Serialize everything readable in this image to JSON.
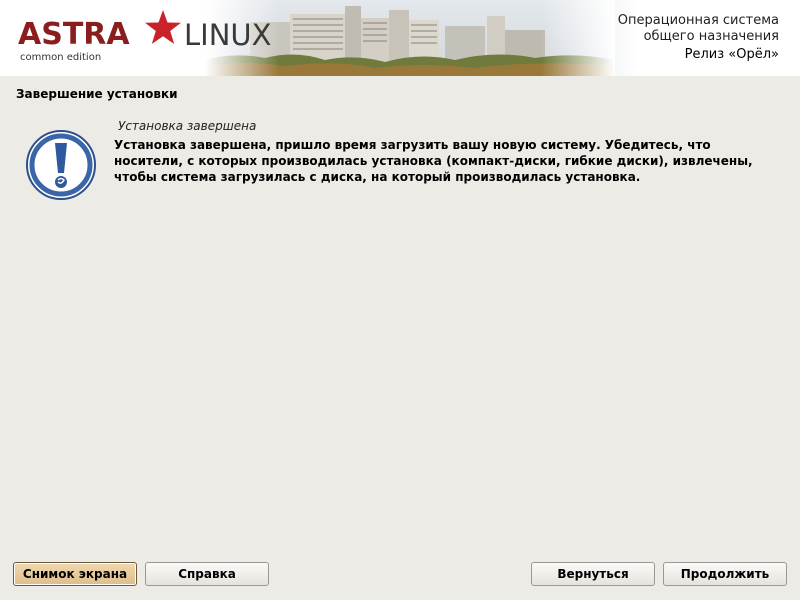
{
  "header": {
    "logo_brand": "ASTRA",
    "logo_product": "LINUX",
    "logo_edition": "common edition",
    "product_line1": "Операционная система",
    "product_line2": "общего назначения",
    "release": "Релиз «Орёл»"
  },
  "page": {
    "title": "Завершение установки"
  },
  "message": {
    "heading": "Установка завершена",
    "body": "Установка завершена, пришло время загрузить вашу новую систему. Убедитесь, что носители, с которых производилась установка (компакт-диски, гибкие диски), извлечены, чтобы система загрузилась с диска, на который производилась установка.",
    "icon": "exclamation-icon"
  },
  "buttons": {
    "screenshot": "Снимок экрана",
    "help": "Справка",
    "back": "Вернуться",
    "continue": "Продолжить"
  },
  "colors": {
    "background": "#edebe6",
    "brand_red": "#8a1d1d",
    "icon_blue": "#3a66a8"
  }
}
